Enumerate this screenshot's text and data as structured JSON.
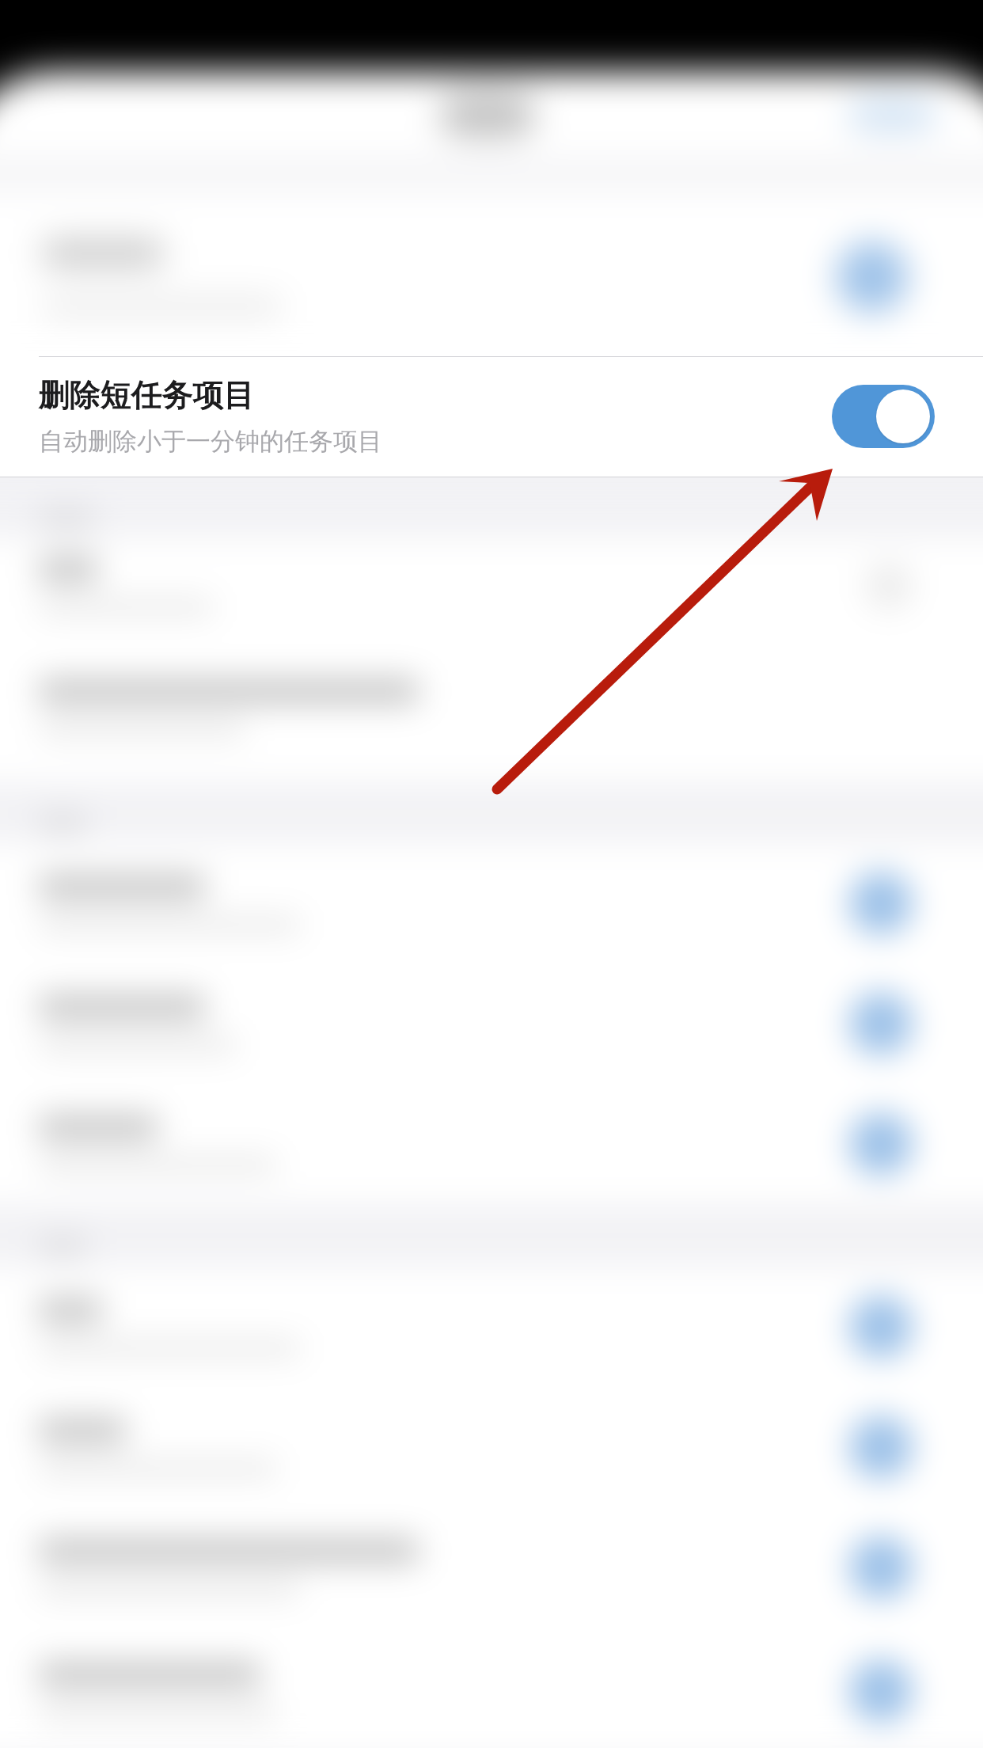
{
  "setting": {
    "title": "删除短任务项目",
    "description": "自动删除小于一分钟的任务项目",
    "on": true
  }
}
